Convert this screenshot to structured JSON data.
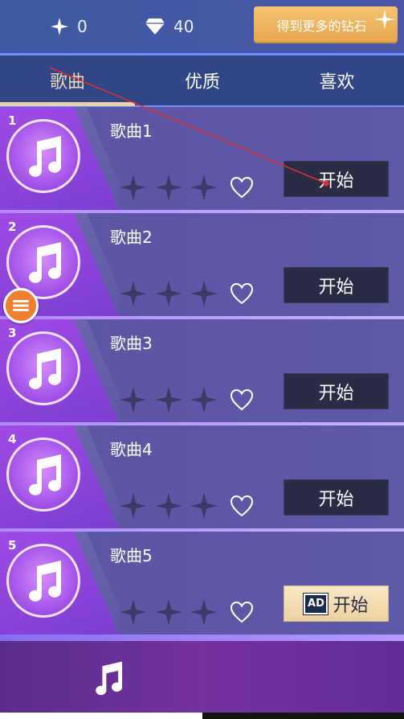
{
  "topbar": {
    "stars_count": "0",
    "diamonds_count": "40",
    "get_more_label": "得到更多的钻石"
  },
  "tabs": [
    {
      "label": "歌曲",
      "selected": true
    },
    {
      "label": "优质",
      "selected": false
    },
    {
      "label": "喜欢",
      "selected": false
    }
  ],
  "songs": [
    {
      "number": "1",
      "title": "歌曲1",
      "start_label": "开始",
      "ad": false
    },
    {
      "number": "2",
      "title": "歌曲2",
      "start_label": "开始",
      "ad": false
    },
    {
      "number": "3",
      "title": "歌曲3",
      "start_label": "开始",
      "ad": false
    },
    {
      "number": "4",
      "title": "歌曲4",
      "start_label": "开始",
      "ad": false
    },
    {
      "number": "5",
      "title": "歌曲5",
      "start_label": "开始",
      "ad": true,
      "ad_label": "AD"
    }
  ],
  "colors": {
    "accent_gold": "#e9d2ad",
    "start_button": "#2a2b45",
    "floating_menu": "#f08030",
    "annotation": "#e03030"
  },
  "icons": {
    "star": "star-icon",
    "diamond": "diamond-icon",
    "sparkle": "sparkle-icon",
    "music": "music-note-icon",
    "heart": "heart-outline-icon",
    "menu": "hamburger-menu-icon"
  }
}
